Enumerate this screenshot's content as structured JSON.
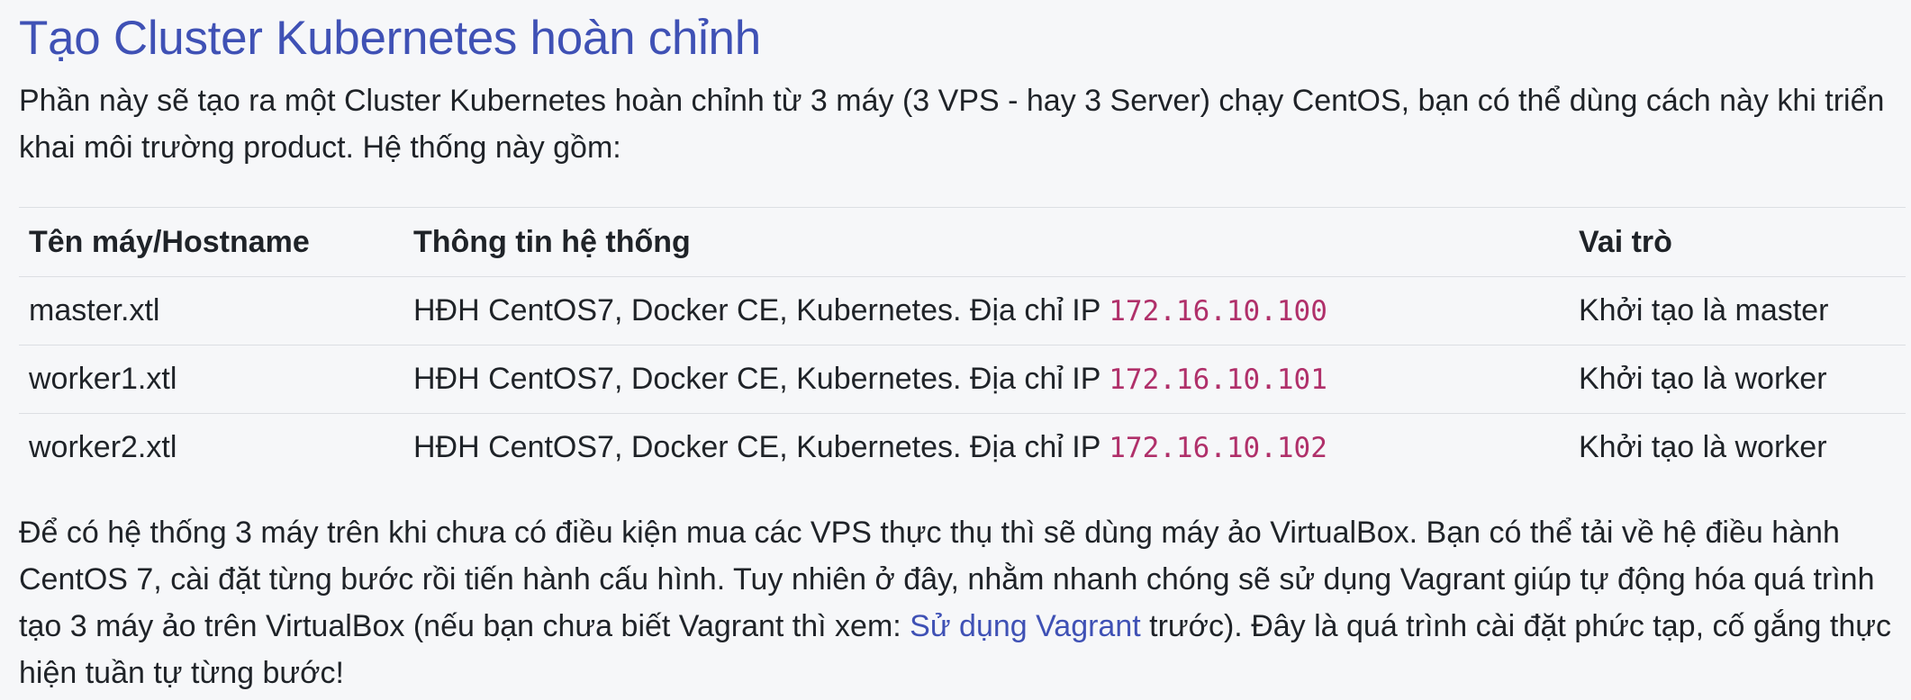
{
  "heading": "Tạo Cluster Kubernetes hoàn chỉnh",
  "intro": "Phần này sẽ tạo ra một Cluster Kubernetes hoàn chỉnh từ 3 máy (3 VPS - hay 3 Server) chạy CentOS, bạn có thể dùng cách này khi triển khai môi trường product. Hệ thống này gồm:",
  "table": {
    "headers": [
      "Tên máy/Hostname",
      "Thông tin hệ thống",
      "Vai trò"
    ],
    "rows": [
      {
        "hostname": "master.xtl",
        "info": "HĐH CentOS7, Docker CE, Kubernetes. Địa chỉ IP ",
        "ip": "172.16.10.100",
        "role": "Khởi tạo là master"
      },
      {
        "hostname": "worker1.xtl",
        "info": "HĐH CentOS7, Docker CE, Kubernetes. Địa chỉ IP ",
        "ip": "172.16.10.101",
        "role": "Khởi tạo là worker"
      },
      {
        "hostname": "worker2.xtl",
        "info": "HĐH CentOS7, Docker CE, Kubernetes. Địa chỉ IP ",
        "ip": "172.16.10.102",
        "role": "Khởi tạo là worker"
      }
    ]
  },
  "outro": {
    "before_link": "Để có hệ thống 3 máy trên khi chưa có điều kiện mua các VPS thực thụ thì sẽ dùng máy ảo VirtualBox. Bạn có thể tải về hệ điều hành CentOS 7, cài đặt từng bước rồi tiến hành cấu hình. Tuy nhiên ở đây, nhằm nhanh chóng sẽ sử dụng Vagrant giúp tự động hóa quá trình tạo 3 máy ảo trên VirtualBox (nếu bạn chưa biết Vagrant thì xem: ",
    "link_text": "Sử dụng Vagrant",
    "after_link": " trước). Đây là quá trình cài đặt phức tạp, cố gắng thực hiện tuần tự từng bước!"
  },
  "colors": {
    "link": "#3f51b5",
    "code": "#b0306a",
    "background": "#f6f7f9"
  }
}
